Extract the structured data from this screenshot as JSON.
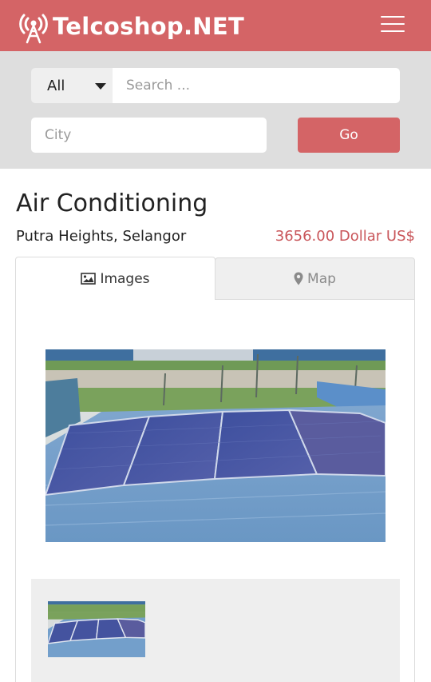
{
  "brand": {
    "name": "Telcoshop.NET",
    "logo_icon": "antenna-tower-icon"
  },
  "nav": {
    "menu_icon": "hamburger-menu-icon"
  },
  "search": {
    "category_value": "All",
    "query_placeholder": "Search ...",
    "city_placeholder": "City",
    "go_label": "Go"
  },
  "listing": {
    "title": "Air Conditioning",
    "location": "Putra Heights, Selangor",
    "price": "3656.00 Dollar US$"
  },
  "tabs": [
    {
      "label": "Images",
      "icon": "image-icon",
      "active": true
    },
    {
      "label": "Map",
      "icon": "map-marker-icon",
      "active": false
    }
  ],
  "gallery": {
    "main_image": "solar-panels-photo",
    "thumbnails": [
      "solar-panels-thumbnail"
    ]
  },
  "colors": {
    "brand": "#d46466",
    "price": "#c9565a",
    "panel_bg": "#dedede"
  }
}
